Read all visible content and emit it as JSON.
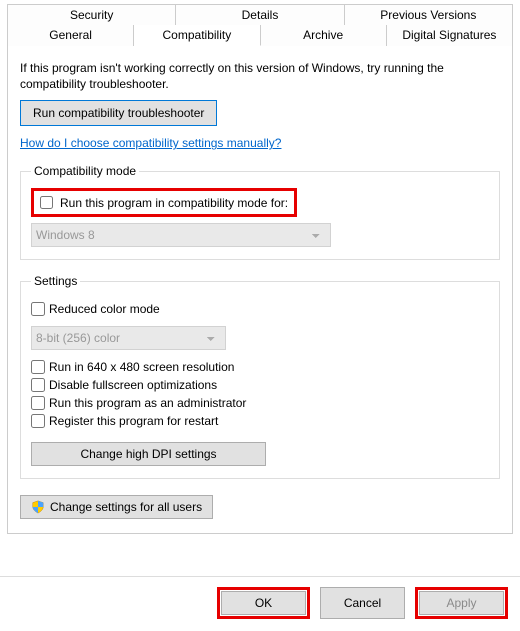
{
  "tabs": {
    "row1": [
      "Security",
      "Details",
      "Previous Versions"
    ],
    "row2": [
      "General",
      "Compatibility",
      "Archive",
      "Digital Signatures"
    ],
    "active": "Compatibility"
  },
  "intro": "If this program isn't working correctly on this version of Windows, try running the compatibility troubleshooter.",
  "buttons": {
    "troubleshooter": "Run compatibility troubleshooter",
    "dpi": "Change high DPI settings",
    "allusers": "Change settings for all users",
    "ok": "OK",
    "cancel": "Cancel",
    "apply": "Apply"
  },
  "link": "How do I choose compatibility settings manually?",
  "groups": {
    "compat_mode": {
      "legend": "Compatibility mode",
      "checkbox": "Run this program in compatibility mode for:",
      "select": "Windows 8"
    },
    "settings": {
      "legend": "Settings",
      "reduced_color": "Reduced color mode",
      "color_select": "8-bit (256) color",
      "run_640": "Run in 640 x 480 screen resolution",
      "disable_fs": "Disable fullscreen optimizations",
      "run_admin": "Run this program as an administrator",
      "register_restart": "Register this program for restart"
    }
  }
}
